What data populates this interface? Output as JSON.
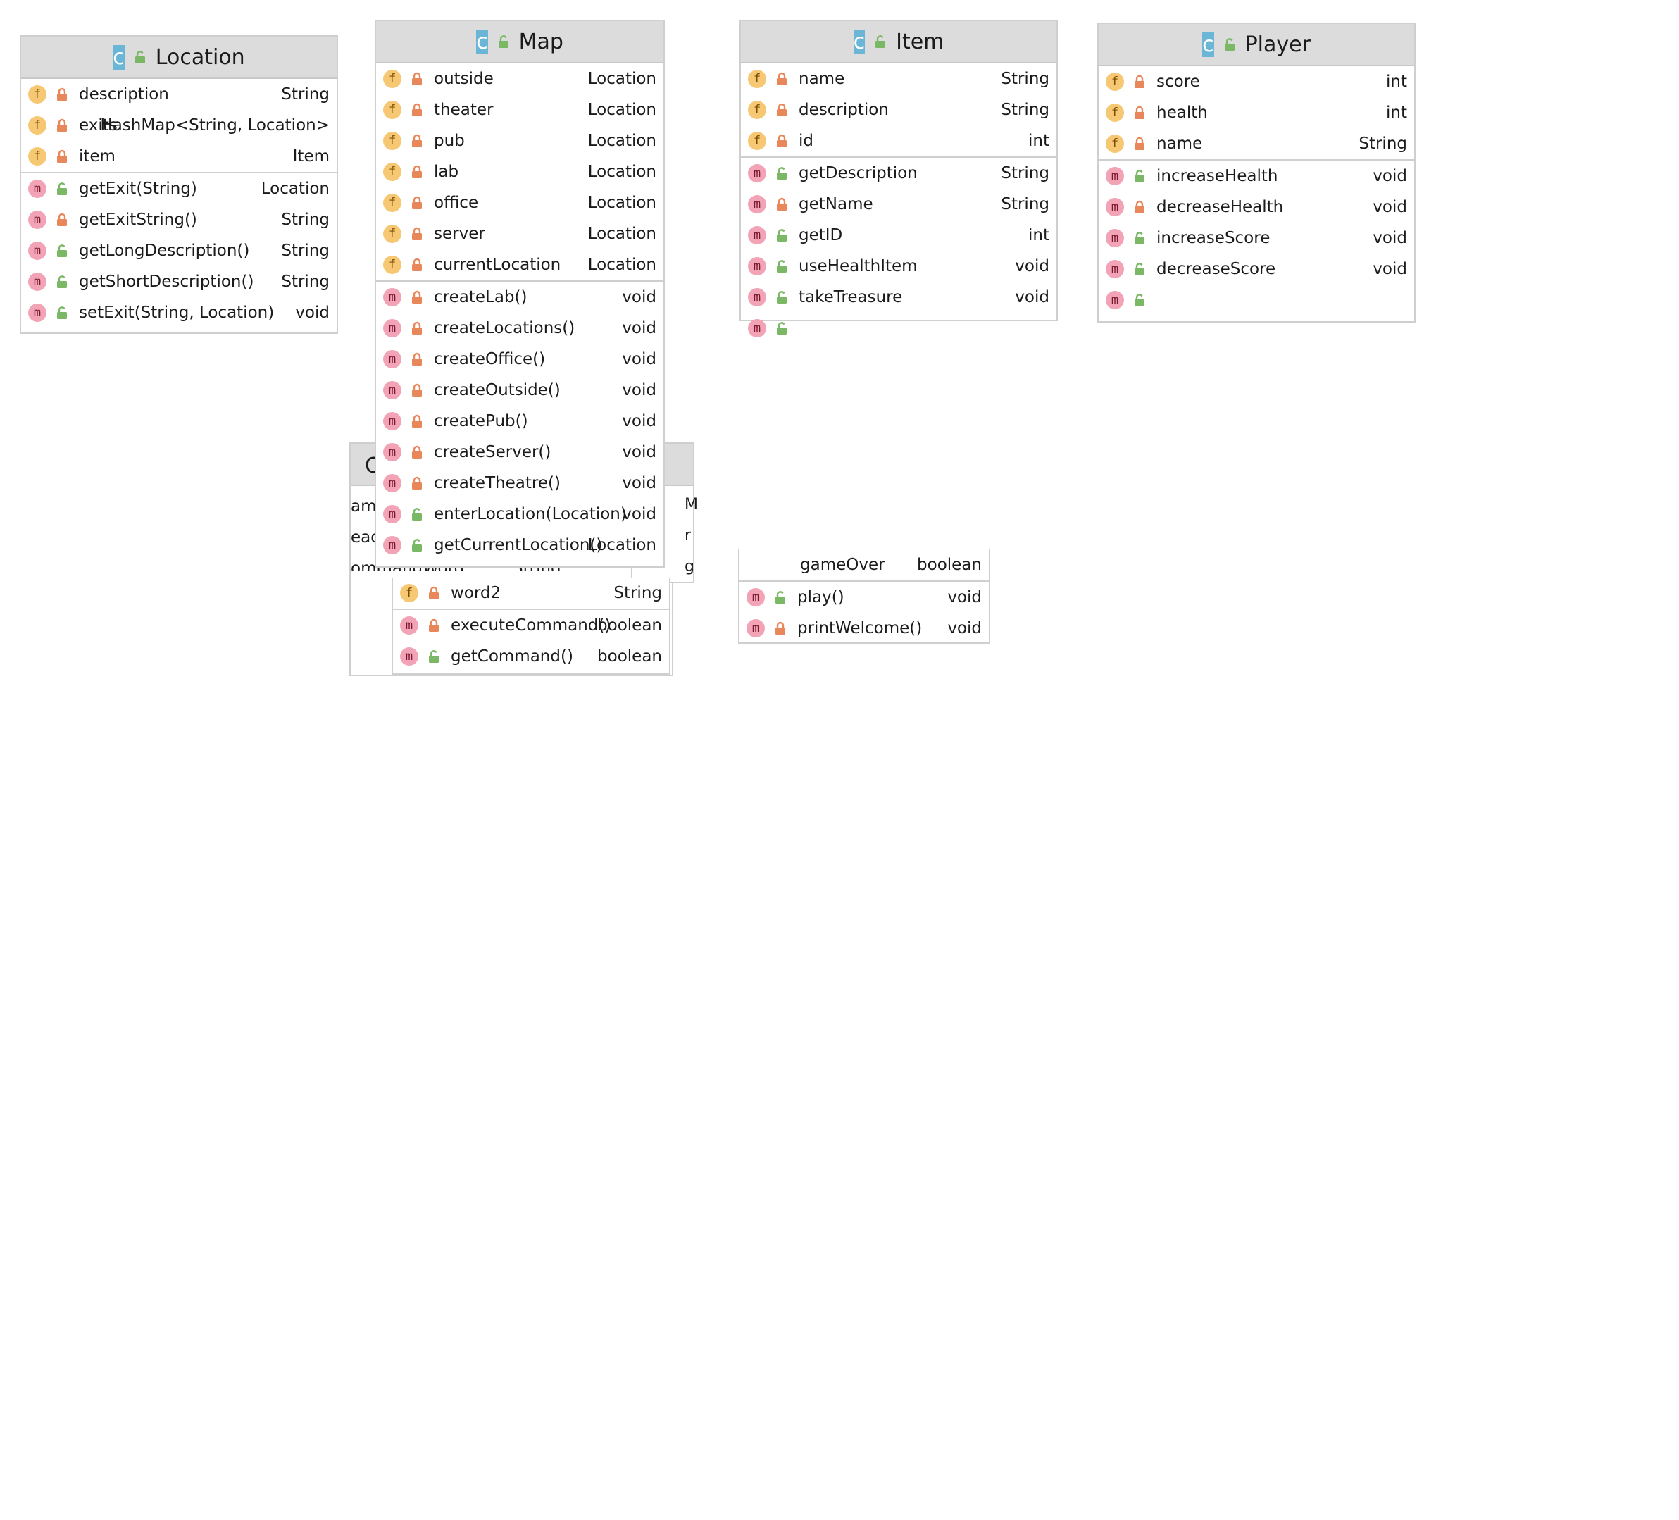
{
  "location": {
    "title": "Location",
    "fields": [
      {
        "name": "description",
        "type": "String",
        "vis": "private"
      },
      {
        "name": "exits",
        "type": "HashMap<String, Location>",
        "vis": "private"
      },
      {
        "name": "item",
        "type": "Item",
        "vis": "private"
      }
    ],
    "methods": [
      {
        "name": "getExit(String)",
        "type": "Location",
        "vis": "public"
      },
      {
        "name": "getExitString()",
        "type": "String",
        "vis": "private"
      },
      {
        "name": "getLongDescription()",
        "type": "String",
        "vis": "public"
      },
      {
        "name": "getShortDescription()",
        "type": "String",
        "vis": "public"
      },
      {
        "name": "setExit(String, Location)",
        "type": "void",
        "vis": "public"
      }
    ]
  },
  "map": {
    "title": "Map",
    "fields": [
      {
        "name": "outside",
        "type": "Location"
      },
      {
        "name": "theater",
        "type": "Location"
      },
      {
        "name": "pub",
        "type": "Location"
      },
      {
        "name": "lab",
        "type": "Location"
      },
      {
        "name": "office",
        "type": "Location"
      },
      {
        "name": "server",
        "type": "Location"
      },
      {
        "name": "currentLocation",
        "type": "Location"
      }
    ],
    "methods": [
      {
        "name": "createLab()",
        "type": "void",
        "vis": "private"
      },
      {
        "name": "createLocations()",
        "type": "void",
        "vis": "private"
      },
      {
        "name": "createOffice()",
        "type": "void",
        "vis": "private"
      },
      {
        "name": "createOutside()",
        "type": "void",
        "vis": "private"
      },
      {
        "name": "createPub()",
        "type": "void",
        "vis": "private"
      },
      {
        "name": "createServer()",
        "type": "void",
        "vis": "private"
      },
      {
        "name": "createTheatre()",
        "type": "void",
        "vis": "private"
      },
      {
        "name": "enterLocation(Location)",
        "type": "void",
        "vis": "public"
      },
      {
        "name": "getCurrentLocation()",
        "type": "Location",
        "vis": "public"
      }
    ]
  },
  "item": {
    "title": "Item",
    "fields": [
      {
        "name": "name",
        "type": "String"
      },
      {
        "name": "description",
        "type": "String"
      },
      {
        "name": "id",
        "type": "int"
      }
    ],
    "methods": [
      {
        "name": "getDescription",
        "type": "String",
        "vis": "public"
      },
      {
        "name": "getName",
        "type": "String",
        "vis": "private"
      },
      {
        "name": "getID",
        "type": "int",
        "vis": "public"
      },
      {
        "name": "useHealthItem",
        "type": "void",
        "vis": "public"
      },
      {
        "name": "takeTreasure",
        "type": "void",
        "vis": "public"
      },
      {
        "name": "",
        "type": "",
        "vis": "public"
      }
    ]
  },
  "player": {
    "title": "Player",
    "fields": [
      {
        "name": "score",
        "type": "int"
      },
      {
        "name": "health",
        "type": "int"
      },
      {
        "name": "name",
        "type": "String"
      }
    ],
    "methods": [
      {
        "name": "increaseHealth",
        "type": "void",
        "vis": "public"
      },
      {
        "name": "decreaseHealth",
        "type": "void",
        "vis": "private"
      },
      {
        "name": "increaseScore",
        "type": "void",
        "vis": "public"
      },
      {
        "name": "decreaseScore",
        "type": "void",
        "vis": "public"
      },
      {
        "name": "",
        "type": "",
        "vis": "public"
      }
    ]
  },
  "command": {
    "title_fragment": "C",
    "field_fragments": [
      "ame",
      "eade",
      "ommandWord"
    ],
    "field_type_fragment": "String",
    "word2": {
      "name": "word2",
      "type": "String"
    },
    "methods": [
      {
        "name": "executeCommand()",
        "type": "boolean",
        "vis": "private"
      },
      {
        "name": "getCommand()",
        "type": "boolean",
        "vis": "public"
      }
    ]
  },
  "hidden_right": {
    "fragments": [
      "M",
      "r",
      "g"
    ]
  },
  "game": {
    "field": {
      "name": "gameOver",
      "type": "boolean"
    },
    "methods": [
      {
        "name": "play()",
        "type": "void",
        "vis": "public"
      },
      {
        "name": "printWelcome()",
        "type": "void",
        "vis": "private"
      }
    ]
  },
  "icons": {
    "field_badge": "f",
    "method_badge": "m",
    "class_badge": "c"
  },
  "colors": {
    "private": "#e8875a",
    "public": "#7ab866",
    "header": "#dcdcdc"
  }
}
